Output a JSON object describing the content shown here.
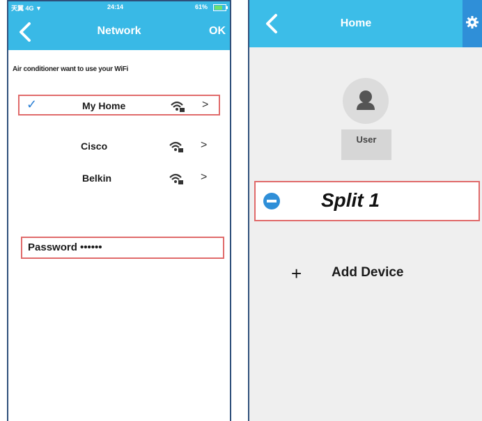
{
  "phone_network": {
    "status_bar": {
      "carrier": "天翼 4G ▼",
      "time": "24:14",
      "battery": "61%"
    },
    "header": {
      "title": "Network",
      "ok_label": "OK"
    },
    "prompt": "Air conditioner want to use your WiFi",
    "networks": [
      {
        "name": "My Home",
        "selected": true,
        "icon": "wifi-locked-icon",
        "chevron": ">"
      },
      {
        "name": "Cisco",
        "selected": false,
        "icon": "wifi-locked-icon",
        "chevron": ">"
      },
      {
        "name": "Belkin",
        "selected": false,
        "icon": "wifi-locked-icon",
        "chevron": ">"
      }
    ],
    "checkmark": "✓",
    "password": {
      "label": "Password",
      "value": "••••••"
    }
  },
  "phone_home": {
    "header": {
      "title": "Home"
    },
    "user": {
      "label": "User"
    },
    "device": {
      "name": "Split 1"
    },
    "add_device": {
      "symbol": "+",
      "label": "Add Device"
    }
  },
  "colors": {
    "header": "#39b9e6",
    "highlight": "#e06a6a",
    "check": "#2a7fd4",
    "remove_icon": "#2f8fd8"
  }
}
